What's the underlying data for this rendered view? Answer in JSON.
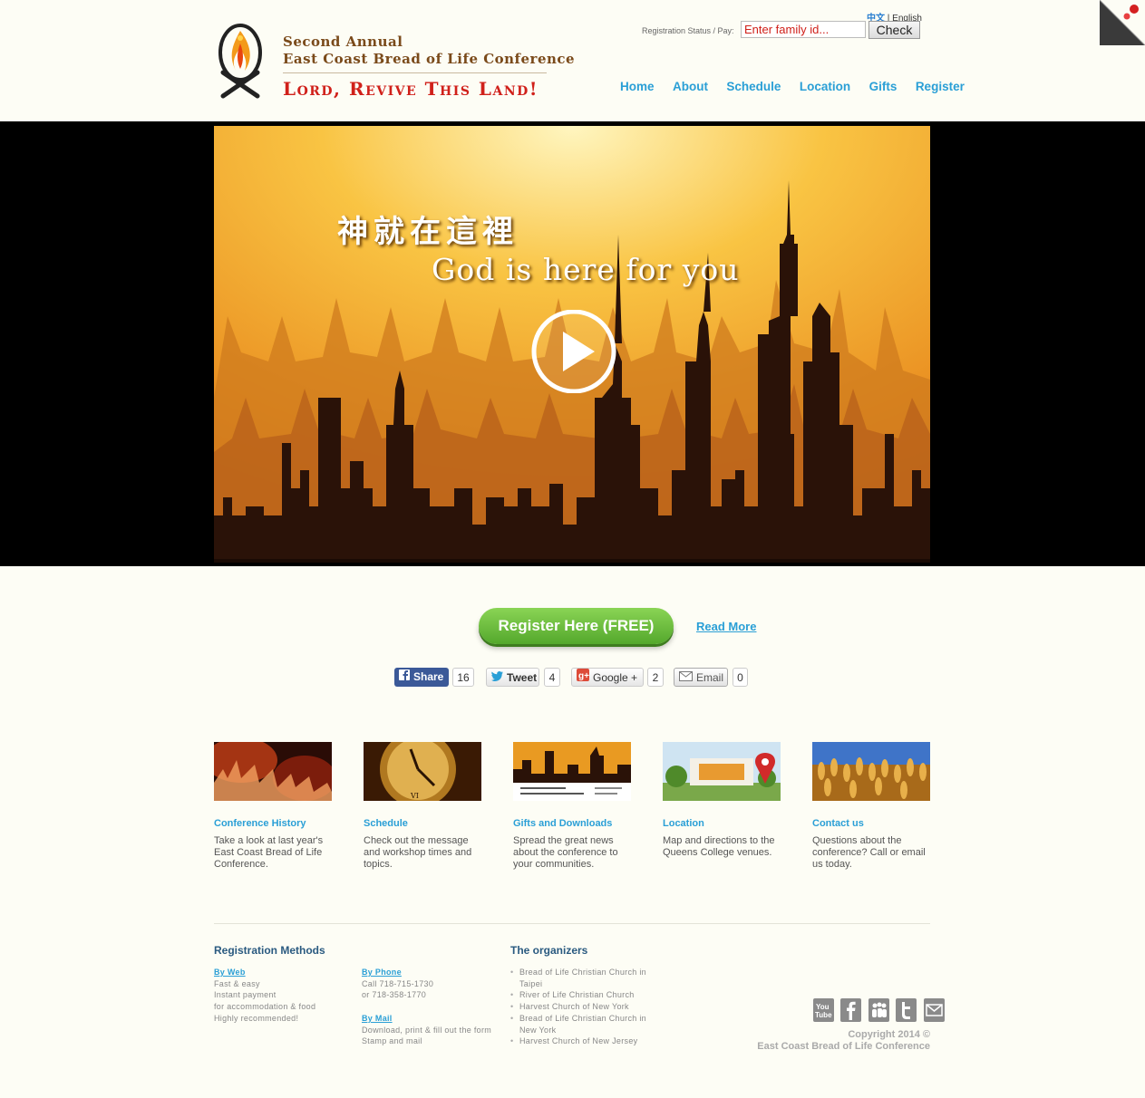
{
  "header": {
    "title_line1": "Second Annual",
    "title_line2": "East Coast Bread of Life Conference",
    "slogan": "Lord, Revive This Land!",
    "lang_zh": "中文",
    "lang_sep": " | ",
    "lang_en": "English",
    "registration_label": "Registration Status / Pay:",
    "family_placeholder": "Enter family id...",
    "check_label": "Check",
    "nav": [
      "Home",
      "About",
      "Schedule",
      "Location",
      "Gifts",
      "Register"
    ]
  },
  "hero": {
    "zh_text": "神就在這裡",
    "en_text": "God is here for you",
    "play_icon": "play-circle-icon",
    "colors": {
      "sky_top": "#fff3b0",
      "sky_mid": "#f7b733",
      "sky_bottom": "#e8871c",
      "silhouette": "#241008",
      "crowd": "#c9741a"
    }
  },
  "actions": {
    "register_label": "Register Here (FREE)",
    "read_more_label": "Read More",
    "register_color": "#6cbf3c"
  },
  "share": {
    "facebook": {
      "label": "Share",
      "count": "16"
    },
    "twitter": {
      "label": "Tweet",
      "count": "4"
    },
    "google": {
      "label": "Google +",
      "count": "2"
    },
    "email": {
      "label": "Email",
      "count": "0"
    }
  },
  "cards": [
    {
      "title": "Conference History",
      "desc": "Take a look at last year's East Coast Bread of Life Conference."
    },
    {
      "title": "Schedule",
      "desc": "Check out the message and workshop times and topics."
    },
    {
      "title": "Gifts and Downloads",
      "desc": "Spread the great news about the conference to your communities."
    },
    {
      "title": "Location",
      "desc": "Map and directions to the Queens College venues."
    },
    {
      "title": "Contact us",
      "desc": "Questions about the conference? Call or email us today."
    }
  ],
  "footer": {
    "methods_title": "Registration Methods",
    "by_web": {
      "link": "By Web",
      "lines": [
        "Fast & easy",
        "Instant payment",
        "for accommodation & food",
        "Highly recommended!"
      ]
    },
    "by_phone": {
      "link": "By Phone",
      "lines": [
        "Call 718-715-1730",
        "or 718-358-1770"
      ]
    },
    "by_mail": {
      "link": "By Mail",
      "lines": [
        "Download, print & fill out the form",
        "Stamp and mail"
      ]
    },
    "organizers_title": "The organizers",
    "organizers": [
      "Bread of Life Christian Church in Taipei",
      "River of Life Christian Church",
      "Harvest Church of New York",
      "Bread of Life Christian Church in New York",
      "Harvest Church of New Jersey"
    ],
    "social_icons": [
      "youtube-icon",
      "facebook-icon",
      "myspace-icon",
      "twitter-icon",
      "email-icon"
    ],
    "copyright_line1": "Copyright 2014 ©",
    "copyright_line2": "East Coast Bread of Life Conference"
  }
}
